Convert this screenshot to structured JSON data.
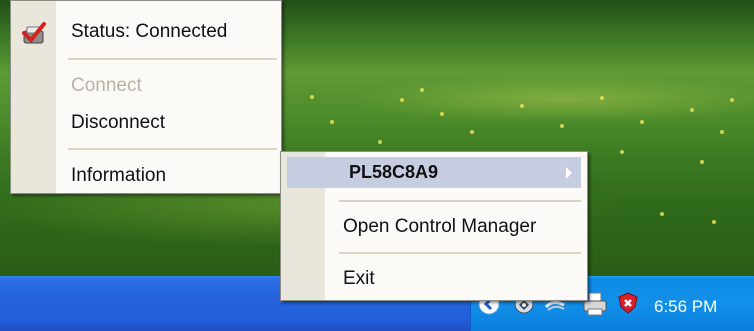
{
  "taskbar": {
    "clock": "6:56 PM",
    "tray_icons": [
      "chevron-left-icon",
      "network-icon",
      "connection-icon",
      "printer-icon",
      "security-shield-icon"
    ]
  },
  "main_menu": {
    "status": "Status: Connected",
    "connect": "Connect",
    "disconnect": "Disconnect",
    "information": "Information"
  },
  "submenu": {
    "device": "PL58C8A9",
    "open_control_manager": "Open Control Manager",
    "exit": "Exit"
  },
  "colors": {
    "taskbar_blue": "#245edb",
    "tray_blue": "#1190ea",
    "menu_bg": "#fbfaf6",
    "menu_gutter": "#e9e6dc",
    "highlight": "#c7cde0",
    "disabled_text": "#b5b3a9"
  }
}
